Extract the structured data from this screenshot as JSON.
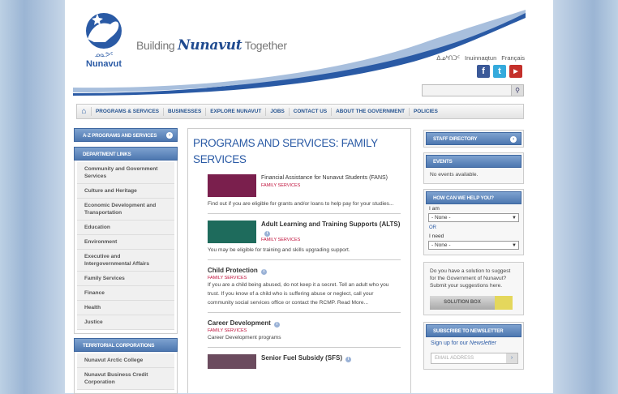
{
  "header": {
    "logo_text": "Nunavut",
    "tagline_pre": "Building",
    "tagline_brand": "Nunavut",
    "tagline_post": "Together",
    "languages": [
      "ᐃᓄᒃᑎᑐᑦ",
      "Inuinnaqtun",
      "Français"
    ],
    "social": [
      "facebook-icon",
      "twitter-icon",
      "youtube-icon"
    ],
    "search_placeholder": ""
  },
  "nav": {
    "items": [
      "PROGRAMS & SERVICES",
      "BUSINESSES",
      "EXPLORE NUNAVUT",
      "JOBS",
      "CONTACT US",
      "ABOUT THE GOVERNMENT",
      "POLICIES"
    ]
  },
  "left": {
    "az_label": "A-Z PROGRAMS AND SERVICES",
    "dept_label": "DEPARTMENT LINKS",
    "dept_links": [
      "Community and Government Services",
      "Culture and Heritage",
      "Economic Development and Transportation",
      "Education",
      "Environment",
      "Executive and Intergovernmental Affairs",
      "Family Services",
      "Finance",
      "Health",
      "Justice"
    ],
    "terr_label": "TERRITORIAL CORPORATIONS",
    "terr_links": [
      "Nunavut Arctic College",
      "Nunavut Business Credit Corporation"
    ]
  },
  "main": {
    "title": "PROGRAMS AND SERVICES: FAMILY SERVICES",
    "programs": [
      {
        "title": "Financial Assistance for Nunavut Students (FANS)",
        "category": "FAMILY SERVICES",
        "desc": "Find out if you are eligible for grants and/or loans to help pay for your studies...",
        "thumb_color": "#7a1f4d"
      },
      {
        "title": "Adult Learning and Training Supports (ALTS)",
        "category": "FAMILY SERVICES",
        "desc": "You may be eligible for training and skills upgrading support.",
        "thumb_color": "#1e6b5c"
      },
      {
        "title": "Child Protection",
        "category": "FAMILY SERVICES",
        "desc": "If you are a child being abused, do not keep it a secret. Tell an adult who you trust. If you know of a child who is suffering abuse or neglect, call your community social services office or contact the RCMP. Read More..."
      },
      {
        "title": "Career Development",
        "category": "FAMILY SERVICES",
        "desc": "Career Development programs"
      },
      {
        "title": "Senior Fuel Subsidy (SFS)",
        "category": "",
        "desc": "",
        "thumb_color": "#6b4b5e"
      }
    ]
  },
  "right": {
    "staff_label": "STAFF DIRECTORY",
    "events_label": "EVENTS",
    "events_text": "No events available.",
    "help_label": "HOW CAN WE HELP YOU?",
    "i_am": "I am",
    "none": "- None -",
    "or": "OR",
    "i_need": "I need",
    "solution_text": "Do you have a solution to suggest for the Government of Nunavut? Submit your suggestions here.",
    "solution_btn": "SOLUTION BOX",
    "newsletter_label": "SUBSCRIBE TO NEWSLETTER",
    "newsletter_text_pre": "Sign up for our",
    "newsletter_text_em": "Newsletter",
    "email_placeholder": "EMAIL ADDRESS"
  }
}
